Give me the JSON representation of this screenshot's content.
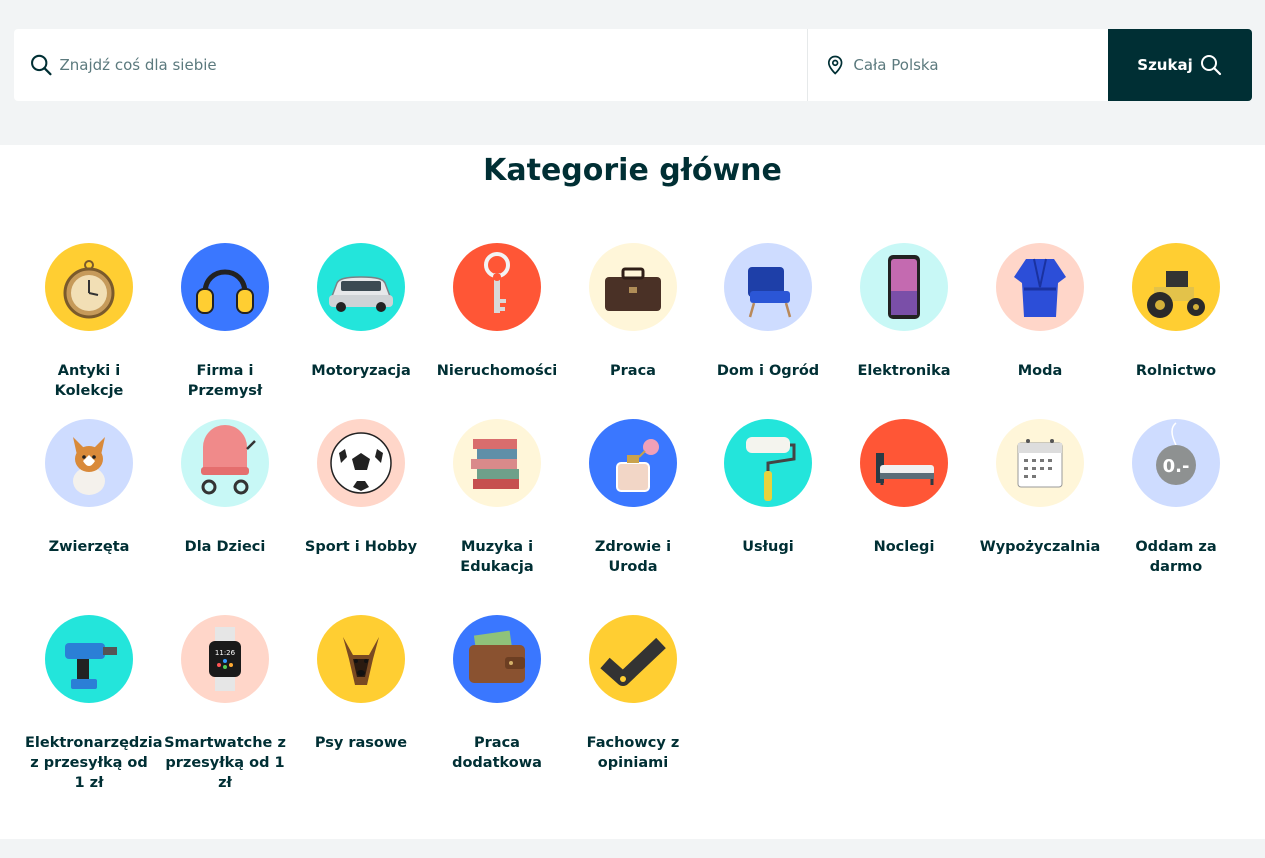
{
  "search": {
    "placeholder": "Znajdź coś dla siebie",
    "location_placeholder": "Cała Polska",
    "button_label": "Szukaj"
  },
  "main": {
    "title": "Kategorie główne",
    "categories": [
      {
        "label": "Antyki i Kolekcje",
        "bg": "#ffce32",
        "icon": "pocket-watch-icon"
      },
      {
        "label": "Firma i Przemysł",
        "bg": "#3a77ff",
        "icon": "ear-muffs-icon"
      },
      {
        "label": "Motoryzacja",
        "bg": "#23e5db",
        "icon": "car-icon"
      },
      {
        "label": "Nieruchomości",
        "bg": "#ff5636",
        "icon": "key-icon"
      },
      {
        "label": "Praca",
        "bg": "#fff6d9",
        "icon": "briefcase-icon"
      },
      {
        "label": "Dom i Ogród",
        "bg": "#cedcff",
        "icon": "armchair-icon"
      },
      {
        "label": "Elektronika",
        "bg": "#c8f8f6",
        "icon": "smartphone-icon"
      },
      {
        "label": "Moda",
        "bg": "#ffd6c9",
        "icon": "robe-icon"
      },
      {
        "label": "Rolnictwo",
        "bg": "#ffce32",
        "icon": "tractor-icon"
      },
      {
        "label": "Zwierzęta",
        "bg": "#cedcff",
        "icon": "corgi-icon"
      },
      {
        "label": "Dla Dzieci",
        "bg": "#c8f8f6",
        "icon": "stroller-icon"
      },
      {
        "label": "Sport i Hobby",
        "bg": "#ffd6c9",
        "icon": "football-icon"
      },
      {
        "label": "Muzyka i Edukacja",
        "bg": "#fff6d9",
        "icon": "books-icon"
      },
      {
        "label": "Zdrowie i Uroda",
        "bg": "#3a77ff",
        "icon": "perfume-icon"
      },
      {
        "label": "Usługi",
        "bg": "#23e5db",
        "icon": "paint-roller-icon"
      },
      {
        "label": "Noclegi",
        "bg": "#ff5636",
        "icon": "bed-icon"
      },
      {
        "label": "Wypożyczalnia",
        "bg": "#fff6d9",
        "icon": "calendar-icon"
      },
      {
        "label": "Oddam za darmo",
        "bg": "#cedcff",
        "icon": "price-tag-icon",
        "tag_text": "0.-"
      },
      {
        "label": "Elektronarzędzia z przesyłką od 1 zł",
        "bg": "#23e5db",
        "icon": "drill-icon"
      },
      {
        "label": "Smartwatche z przesyłką od 1 zł",
        "bg": "#ffd6c9",
        "icon": "smartwatch-icon",
        "watch_time": "11:26"
      },
      {
        "label": "Psy rasowe",
        "bg": "#ffce32",
        "icon": "german-shepherd-icon"
      },
      {
        "label": "Praca dodatkowa",
        "bg": "#3a77ff",
        "icon": "wallet-icon"
      },
      {
        "label": "Fachowcy z opiniami",
        "bg": "#ffce32",
        "icon": "check-mark-icon"
      }
    ]
  }
}
